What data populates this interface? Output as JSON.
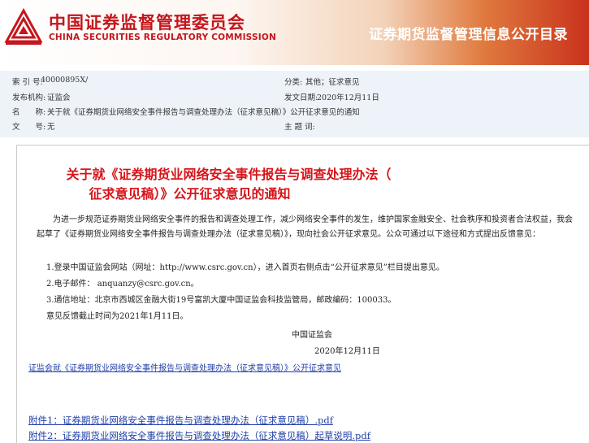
{
  "header": {
    "logo_cn": "中国证券监督管理委员会",
    "logo_en": "CHINA SECURITIES REGULATORY COMMISSION",
    "title": "证券期货监督管理信息公开目录"
  },
  "meta": {
    "index_label": "索 引 号:",
    "index_value": "40000895X/",
    "category_label": "分类:",
    "category_value": "其他；征求意见",
    "publisher_label": "发布机构:",
    "publisher_value": "证监会",
    "date_label": "发文日期:",
    "date_value": "2020年12月11日",
    "name_label": "名　　称:",
    "name_value": "关于就《证券期货业网络安全事件报告与调查处理办法（征求意见稿）》公开征求意见的通知",
    "docno_label": "文　　号:",
    "docno_value": "无",
    "keywords_label": "主 题 词:",
    "keywords_value": ""
  },
  "document": {
    "title_line1": "关于就《证券期货业网络安全事件报告与调查处理办法（",
    "title_line2": "征求意见稿）》公开征求意见的通知",
    "intro": "为进一步规范证券期货业网络安全事件的报告和调查处理工作，减少网络安全事件的发生，维护国家金融安全、社会秩序和投资者合法权益，我会起草了《证券期货业网络安全事件报告与调查处理办法（征求意见稿）》，现向社会公开征求意见。公众可通过以下途径和方式提出反馈意见：",
    "item1": "1.登录中国证监会网站（网址：http://www.csrc.gov.cn），进入首页右侧点击“公开征求意见”栏目提出意见。",
    "item2": "2.电子邮件：  anquanzy@csrc.gov.cn。",
    "item3": "3.通信地址：北京市西城区金融大街19号富凯大厦中国证监会科技监管局，邮政编码：100033。",
    "deadline": "意见反馈截止时间为2021年1月11日。",
    "signature_org": "中国证监会",
    "signature_date": "2020年12月11日",
    "link_main": "证监会就《证券期货业网络安全事件报告与调查处理办法（征求意见稿）》公开征求意见",
    "attachment1": "附件1：证券期货业网络安全事件报告与调查处理办法（征求意见稿）.pdf",
    "attachment2": "附件2：证券期货业网络安全事件报告与调查处理办法（征求意见稿）起草说明.pdf"
  },
  "colors": {
    "brand_red": "#c4161c",
    "title_red": "#d7141a",
    "link_blue": "#1f3ea8",
    "meta_bg": "#eef3f9"
  },
  "icons": {
    "logo": "csrc-emblem-icon"
  }
}
